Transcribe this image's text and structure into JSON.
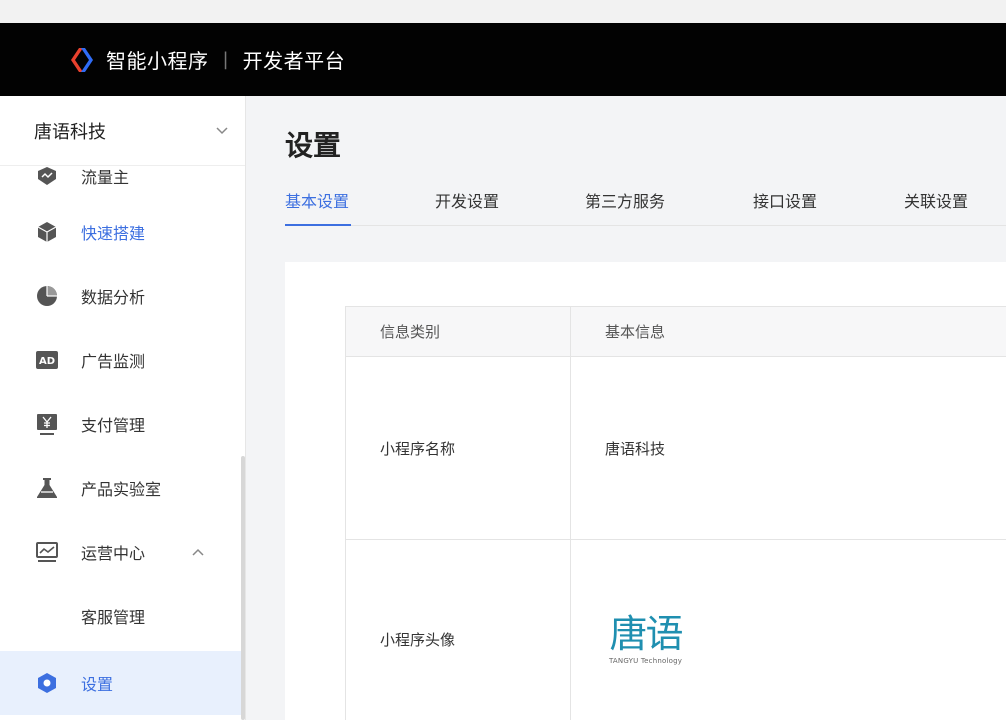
{
  "header": {
    "brand": "智能小程序",
    "separator": "|",
    "platform": "开发者平台"
  },
  "sidebar": {
    "account": "唐语科技",
    "items": [
      {
        "label": "流量主",
        "icon": "traffic-icon"
      },
      {
        "label": "快速搭建",
        "icon": "cube-icon"
      },
      {
        "label": "数据分析",
        "icon": "pie-chart-icon"
      },
      {
        "label": "广告监测",
        "icon": "ad-icon"
      },
      {
        "label": "支付管理",
        "icon": "yuan-icon"
      },
      {
        "label": "产品实验室",
        "icon": "flask-icon"
      },
      {
        "label": "运营中心",
        "icon": "trend-chart-icon"
      },
      {
        "label": "客服管理"
      },
      {
        "label": "设置",
        "icon": "gear-icon"
      }
    ]
  },
  "main": {
    "title": "设置",
    "tabs": [
      "基本设置",
      "开发设置",
      "第三方服务",
      "接口设置",
      "关联设置"
    ],
    "table": {
      "headers": [
        "信息类别",
        "基本信息"
      ],
      "rows": [
        {
          "label": "小程序名称",
          "value": "唐语科技"
        },
        {
          "label": "小程序头像",
          "logo_text": "唐语",
          "logo_sub": "TANGYU Technology"
        }
      ]
    }
  },
  "colors": {
    "accent": "#3c6fe0",
    "header_bg": "#020202",
    "active_bg": "#e8f0fd"
  }
}
